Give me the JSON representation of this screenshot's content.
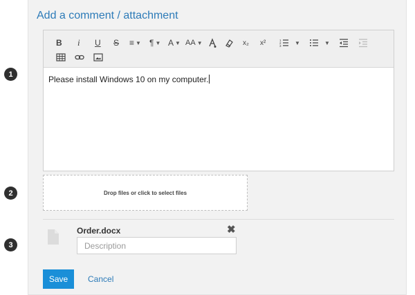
{
  "panel": {
    "title": "Add a comment / attachment"
  },
  "toolbar": {
    "bold": "B",
    "italic": "i",
    "underline": "U",
    "strikethrough": "S",
    "align": "≡",
    "paragraph": "¶",
    "font_color": "A",
    "font_size": "AA",
    "subscript": "x₂",
    "superscript": "x²"
  },
  "editor": {
    "content": "Please install Windows 10 on my computer."
  },
  "dropzone": {
    "label": "Drop files or click to select files"
  },
  "attachment": {
    "file_name": "Order.docx",
    "description_placeholder": "Description",
    "remove_icon": "✖"
  },
  "actions": {
    "save_label": "Save",
    "cancel_label": "Cancel"
  },
  "badges": [
    "1",
    "2",
    "3"
  ],
  "colors": {
    "accent": "#2d7bb8",
    "save_button": "#1a8fd8",
    "badge": "#2f2f2f"
  }
}
